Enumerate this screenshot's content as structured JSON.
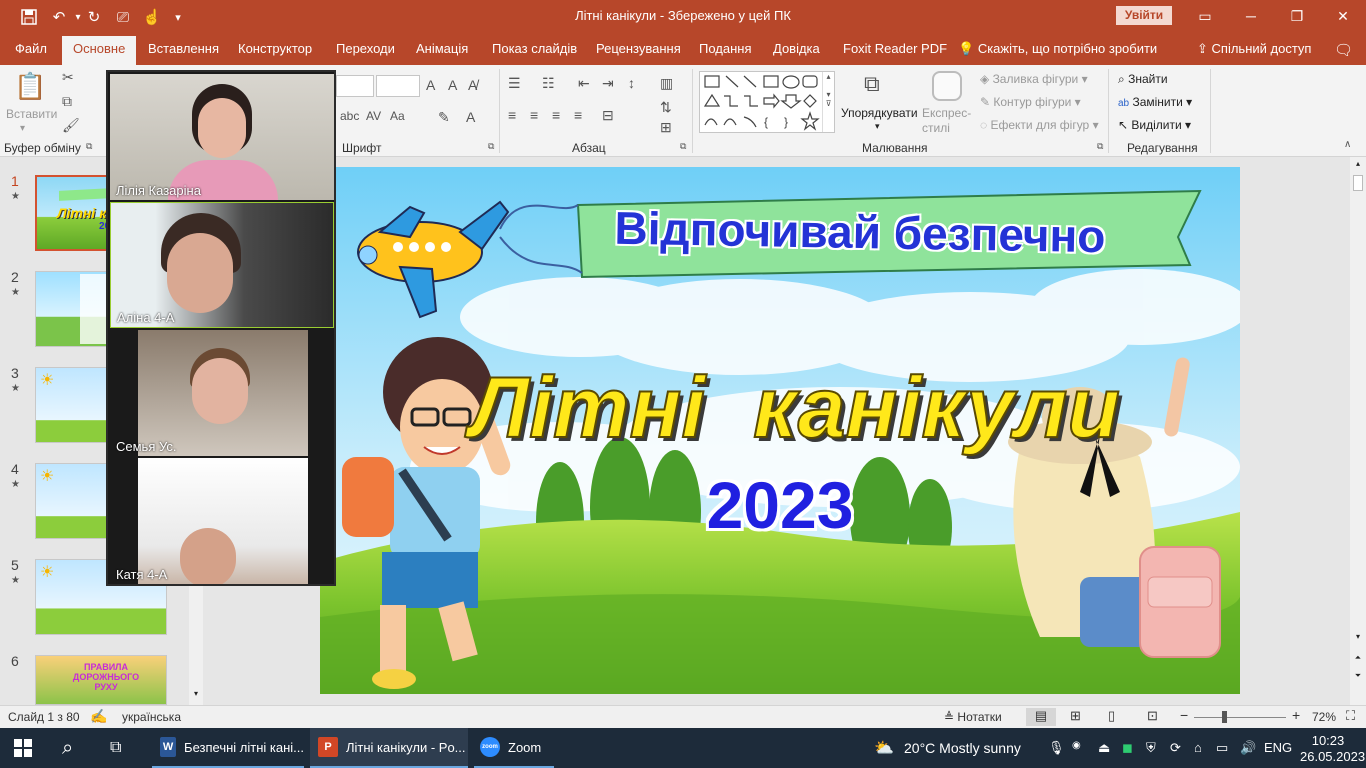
{
  "titlebar": {
    "document_title": "Літні канікули  -  Збережено у цей ПК",
    "sign_in": "Увійти"
  },
  "tabs": [
    "Файл",
    "Основне",
    "Вставлення",
    "Конструктор",
    "Переходи",
    "Анімація",
    "Показ слайдів",
    "Рецензування",
    "Подання",
    "Довідка",
    "Foxit Reader PDF"
  ],
  "tell_me": "Скажіть, що потрібно зробити",
  "share": "Спільний доступ",
  "ribbon": {
    "clipboard": {
      "paste": "Вставити",
      "label": "Буфер обміну"
    },
    "font": {
      "label": "Шрифт"
    },
    "paragraph": {
      "label": "Абзац"
    },
    "drawing": {
      "arrange": "Упорядкувати",
      "quick_styles": "Експрес-стилі",
      "shape_fill": "Заливка фігури",
      "shape_outline": "Контур фігури",
      "shape_effects": "Ефекти для фігур",
      "label": "Малювання"
    },
    "editing": {
      "find": "Знайти",
      "replace": "Замінити",
      "select": "Виділити",
      "label": "Редагування"
    }
  },
  "thumbnails": [
    {
      "num": "1",
      "star": "★"
    },
    {
      "num": "2",
      "star": "★"
    },
    {
      "num": "3",
      "star": "★"
    },
    {
      "num": "4",
      "star": "★"
    },
    {
      "num": "5",
      "star": "★"
    },
    {
      "num": "6",
      "star": "",
      "text": "ПРАВИЛА ДОРОЖНЬОГО РУХУ"
    }
  ],
  "slide": {
    "banner": "Відпочивай безпечно",
    "title": "Літні  канікули",
    "year": "2023"
  },
  "participants": [
    {
      "name": "Лілія Казаріна"
    },
    {
      "name": "Аліна 4-А"
    },
    {
      "name": "Семья Ус."
    },
    {
      "name": "Катя  4-А"
    }
  ],
  "statusbar": {
    "slide": "Слайд 1 з 80",
    "language": "українська",
    "notes": "Нотатки",
    "zoom": "72%"
  },
  "taskbar": {
    "apps": [
      {
        "label": "Безпечні літні кані...",
        "icon": "W"
      },
      {
        "label": "Літні канікули - Po...",
        "icon": "P"
      },
      {
        "label": "Zoom",
        "icon": "zoom"
      }
    ],
    "weather": "20°C  Mostly sunny",
    "lang": "ENG",
    "time": "10:23",
    "date": "26.05.2023"
  }
}
